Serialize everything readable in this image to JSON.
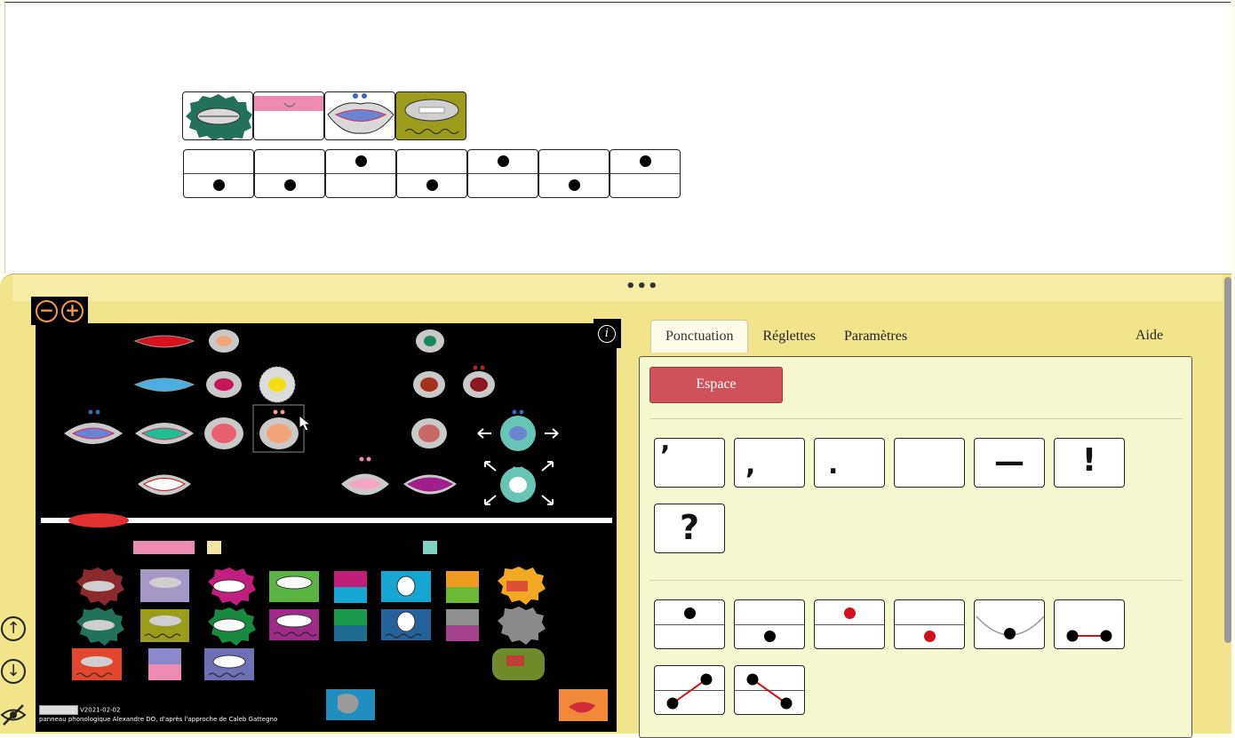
{
  "zoom": {
    "minus": "−",
    "plus": "+"
  },
  "info": {
    "label": "i"
  },
  "credits": {
    "version": "V2021-02-02",
    "line": "panneau phonologique Alexandre DO,  d'après l'approche de Caleb Gattegno"
  },
  "tabs": [
    {
      "label": "Ponctuation",
      "active": true
    },
    {
      "label": "Réglettes",
      "active": false
    },
    {
      "label": "Paramètres",
      "active": false
    }
  ],
  "help_label": "Aide",
  "espace_label": "Espace",
  "punctuation": [
    "’",
    ",",
    ".",
    "",
    "—",
    "!",
    "?"
  ],
  "nav": {
    "up": "↑",
    "down": "↓"
  },
  "colors": {
    "panel": "#f0e58c",
    "espace": "#cf5258",
    "board": "#000000",
    "accent": "#f29a45"
  }
}
